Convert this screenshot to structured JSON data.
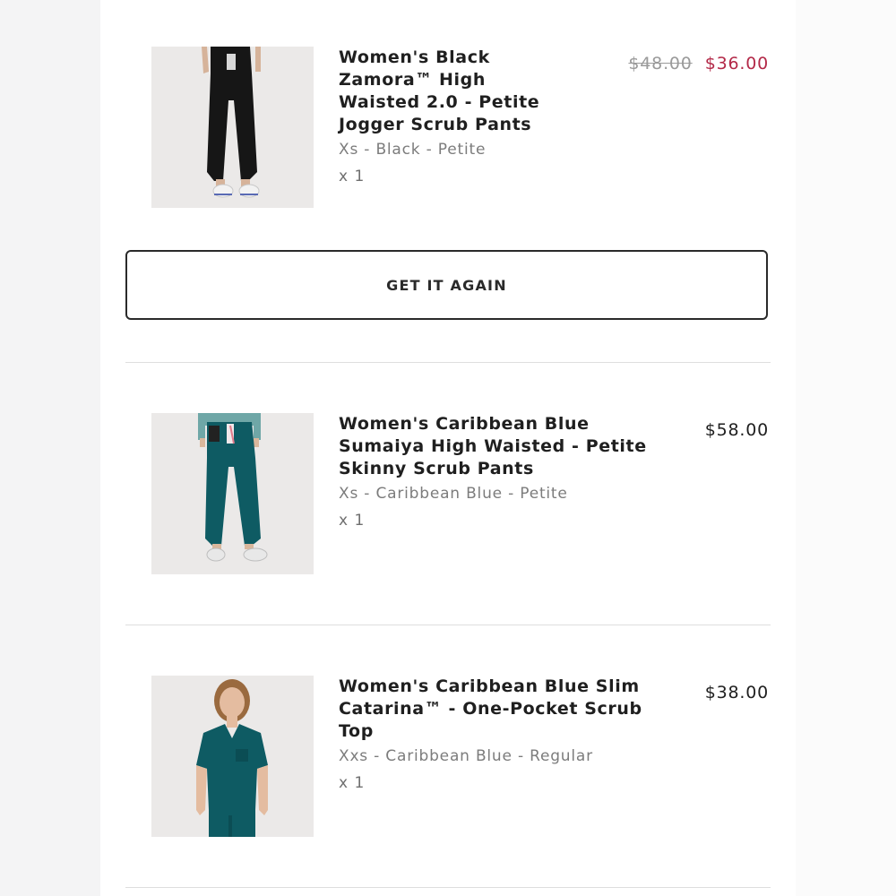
{
  "order_items": [
    {
      "title_lines": [
        "Women's Black",
        "Zamora™ High",
        "Waisted 2.0 - Petite",
        "Jogger Scrub Pants"
      ],
      "variant": "Xs - Black - Petite",
      "quantity": "x 1",
      "original_price": "$48.00",
      "sale_price": "$36.00",
      "image": "black-jogger-pants-photo"
    },
    {
      "title_lines": [
        "Women's Caribbean Blue",
        "Sumaiya High Waisted  - Petite",
        "Skinny Scrub Pants"
      ],
      "variant": "Xs - Caribbean Blue - Petite",
      "quantity": "x 1",
      "price": "$58.00",
      "image": "caribbean-blue-pants-photo"
    },
    {
      "title_lines": [
        "Women's Caribbean Blue Slim",
        "Catarina™ - One-Pocket Scrub",
        "Top"
      ],
      "variant": "Xxs - Caribbean Blue - Regular",
      "quantity": "x 1",
      "price": "$38.00",
      "image": "caribbean-blue-top-photo"
    }
  ],
  "actions": {
    "get_it_again_label": "GET IT AGAIN"
  },
  "colors": {
    "sale_price": "#b32948",
    "text": "#1f1f1f",
    "muted": "#7c7c7c",
    "scrub_teal": "#0e5b63"
  }
}
